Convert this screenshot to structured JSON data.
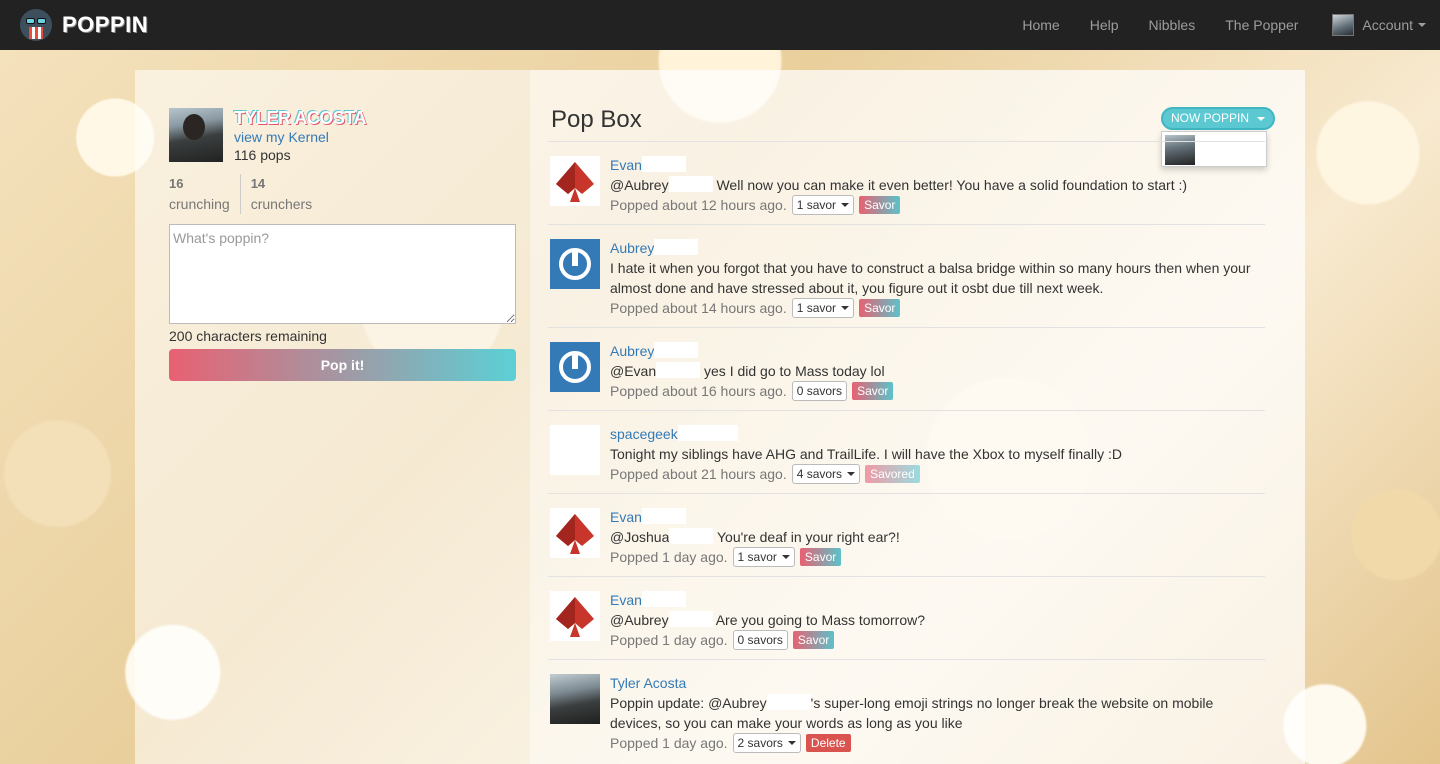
{
  "nav": {
    "brand": "POPPIN",
    "links": [
      "Home",
      "Help",
      "Nibbles",
      "The Popper"
    ],
    "account_label": "Account"
  },
  "profile": {
    "name": "TYLER ACOSTA",
    "kernel_link": "view my Kernel",
    "pops": "116 pops",
    "crunching_count": "16",
    "crunching_label": "crunching",
    "crunchers_count": "14",
    "crunchers_label": "crunchers"
  },
  "composer": {
    "placeholder": "What's poppin?",
    "chars_remaining": "200 characters remaining",
    "submit_label": "Pop it!"
  },
  "popbox": {
    "title": "Pop Box",
    "now_poppin_label": "NOW POPPIN"
  },
  "posts": [
    {
      "user": "Evan",
      "avatar": "spade-icon",
      "mention": "@Aubrey",
      "text": "Well now you can make it even better! You have a solid foundation to start :)",
      "time": "Popped about 12 hours ago.",
      "savors": "1 savor",
      "action": "Savor"
    },
    {
      "user": "Aubrey",
      "avatar": "power-icon",
      "mention": "",
      "text": "I hate it when you forgot that you have to construct a balsa bridge within so many hours then when your almost done and have stressed about it, you figure out it osbt due till next week.",
      "time": "Popped about 14 hours ago.",
      "savors": "1 savor",
      "action": "Savor"
    },
    {
      "user": "Aubrey",
      "avatar": "power-icon",
      "mention": "@Evan",
      "text": "yes I did go to Mass today lol",
      "time": "Popped about 16 hours ago.",
      "savors": "0 savors",
      "action": "Savor"
    },
    {
      "user": "spacegeek",
      "avatar": "blank",
      "mention": "",
      "text": "Tonight my siblings have AHG and TrailLife. I will have the Xbox to myself finally :D",
      "time": "Popped about 21 hours ago.",
      "savors": "4 savors",
      "action": "Savored"
    },
    {
      "user": "Evan",
      "avatar": "spade-icon",
      "mention": "@Joshua",
      "text": "You're deaf in your right ear?!",
      "time": "Popped 1 day ago.",
      "savors": "1 savor",
      "action": "Savor"
    },
    {
      "user": "Evan",
      "avatar": "spade-icon",
      "mention": "@Aubrey",
      "text": "Are you going to Mass tomorrow?",
      "time": "Popped 1 day ago.",
      "savors": "0 savors",
      "action": "Savor"
    },
    {
      "user": "Tyler Acosta",
      "avatar": "photo",
      "mention": "Poppin update: @Aubrey",
      "text": "'s super-long emoji strings no longer break the website on mobile devices, so you can make your words as long as you like",
      "time": "Popped 1 day ago.",
      "savors": "2 savors",
      "action": "Delete"
    }
  ]
}
